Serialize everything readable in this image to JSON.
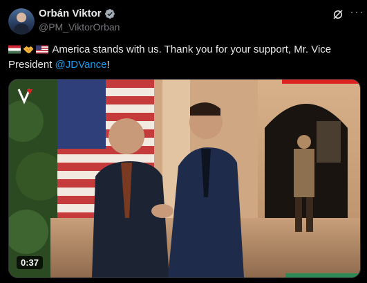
{
  "author": {
    "name": "Orbán Viktor",
    "handle": "@PM_ViktorOrban"
  },
  "post": {
    "emojis": [
      "flag-hungary",
      "handshake",
      "flag-usa"
    ],
    "text_main": " America stands with us. Thank you for your support, Mr. Vice President ",
    "mention": "@JDVance",
    "text_end": "!"
  },
  "video": {
    "duration": "0:37"
  },
  "colors": {
    "background": "#000000",
    "text": "#e7e9ea",
    "secondary": "#71767b",
    "accent": "#1d9bf0"
  }
}
